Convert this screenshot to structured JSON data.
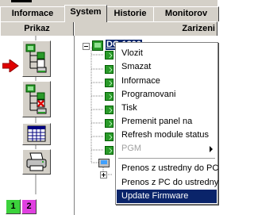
{
  "tabs": [
    {
      "label": "Informace"
    },
    {
      "label": "System"
    },
    {
      "label": "Historie"
    },
    {
      "label": "Monitorov"
    }
  ],
  "columns": {
    "left": "Prikaz",
    "right": "Zarizeni"
  },
  "tree": {
    "root_label": "DC-1200"
  },
  "context_menu": {
    "items": [
      {
        "label": "Vlozit",
        "state": "enabled"
      },
      {
        "label": "Smazat",
        "state": "enabled"
      },
      {
        "label": "Informace",
        "state": "enabled"
      },
      {
        "label": "Programovani",
        "state": "enabled"
      },
      {
        "label": "Tisk",
        "state": "enabled"
      },
      {
        "label": "Premenit panel na",
        "state": "enabled"
      },
      {
        "label": "Refresh module status",
        "state": "enabled"
      },
      {
        "label": "PGM",
        "state": "disabled",
        "submenu": true
      },
      {
        "label": "Prenos z ustredny do PC",
        "state": "enabled"
      },
      {
        "label": "Prenos z PC do ustredny",
        "state": "enabled"
      },
      {
        "label": "Update Firmware",
        "state": "selected"
      }
    ]
  },
  "toolbar_buttons": [
    {
      "icon": "download-to-panel-icon"
    },
    {
      "icon": "delete-device-icon"
    },
    {
      "icon": "calendar-grid-icon"
    },
    {
      "icon": "printer-icon"
    },
    {
      "icon": "color-keys-icon",
      "keys": [
        "1",
        "2"
      ]
    }
  ],
  "colors": {
    "window_face": "#d4d0c8",
    "selection": "#0a246a",
    "node_green": "#2a9a2a",
    "arrow_red": "#e00000"
  }
}
